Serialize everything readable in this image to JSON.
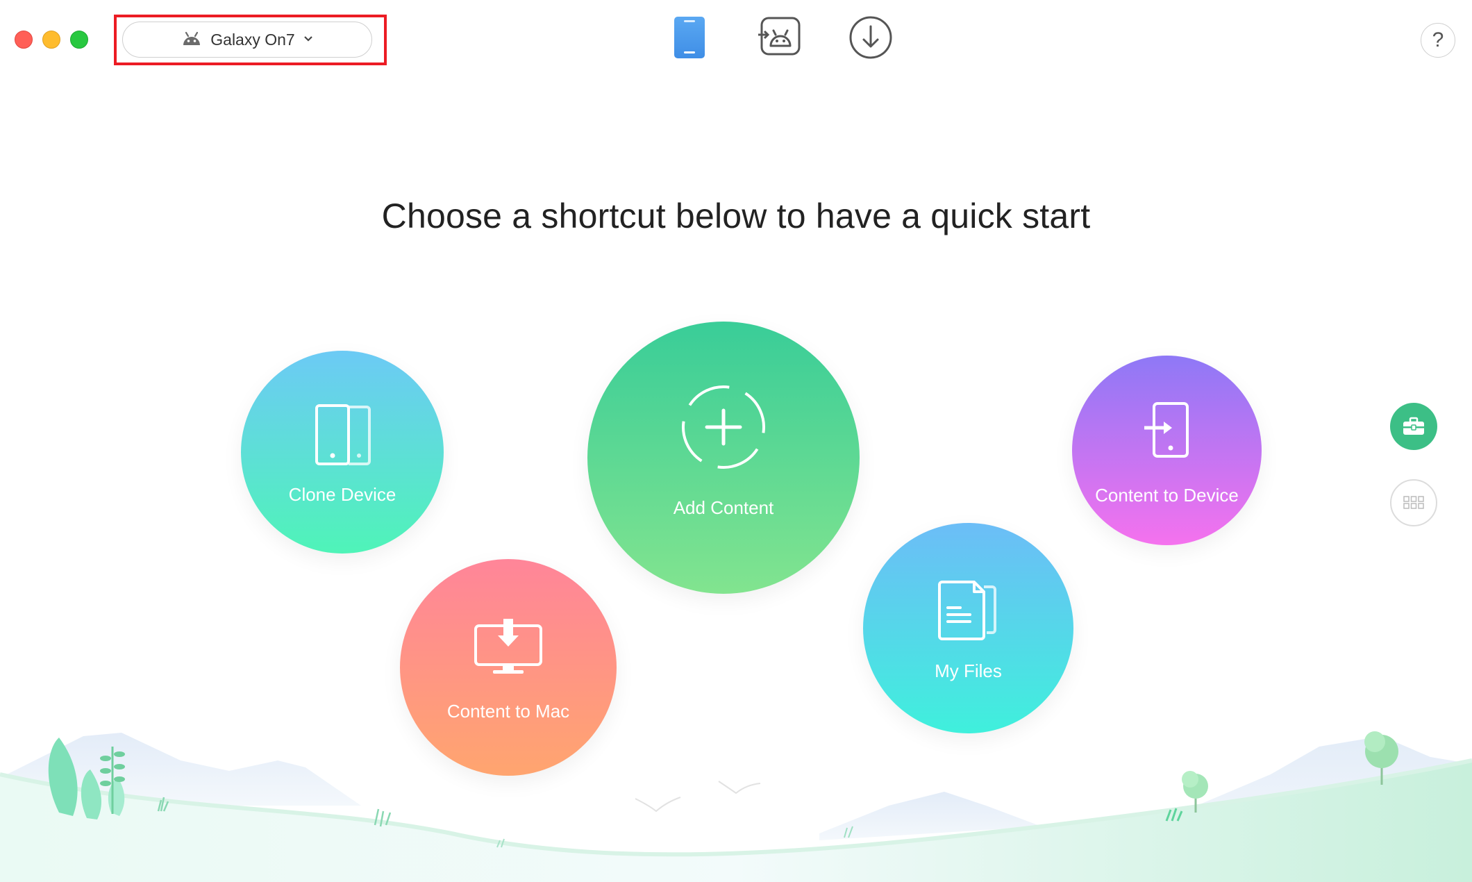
{
  "window": {
    "controls": [
      "close",
      "minimize",
      "zoom"
    ]
  },
  "device_selector": {
    "device_name": "Galaxy On7",
    "icon": "android-icon",
    "dropdown_icon": "chevron-down-icon"
  },
  "toolbar": {
    "tabs": [
      {
        "name": "device-manager",
        "icon": "phone-icon",
        "active": true
      },
      {
        "name": "android-mover",
        "icon": "android-transfer-icon",
        "active": false
      },
      {
        "name": "downloader",
        "icon": "download-circle-icon",
        "active": false
      }
    ],
    "help_label": "?"
  },
  "main": {
    "headline": "Choose a shortcut below to have a quick start",
    "shortcuts": [
      {
        "label": "Clone Device",
        "icon": "clone-device-icon"
      },
      {
        "label": "Add Content",
        "icon": "add-content-icon"
      },
      {
        "label": "Content to Mac",
        "icon": "content-to-mac-icon"
      },
      {
        "label": "My Files",
        "icon": "my-files-icon"
      },
      {
        "label": "Content to Device",
        "icon": "content-to-device-icon"
      }
    ]
  },
  "side_buttons": [
    {
      "name": "toolbox",
      "icon": "toolbox-icon",
      "active": true
    },
    {
      "name": "grid",
      "icon": "grid-icon",
      "active": false
    }
  ],
  "colors": {
    "highlight_box": "#ec1c24",
    "accent_green": "#3cbf86",
    "tab_blue": "#4aa3f0"
  }
}
